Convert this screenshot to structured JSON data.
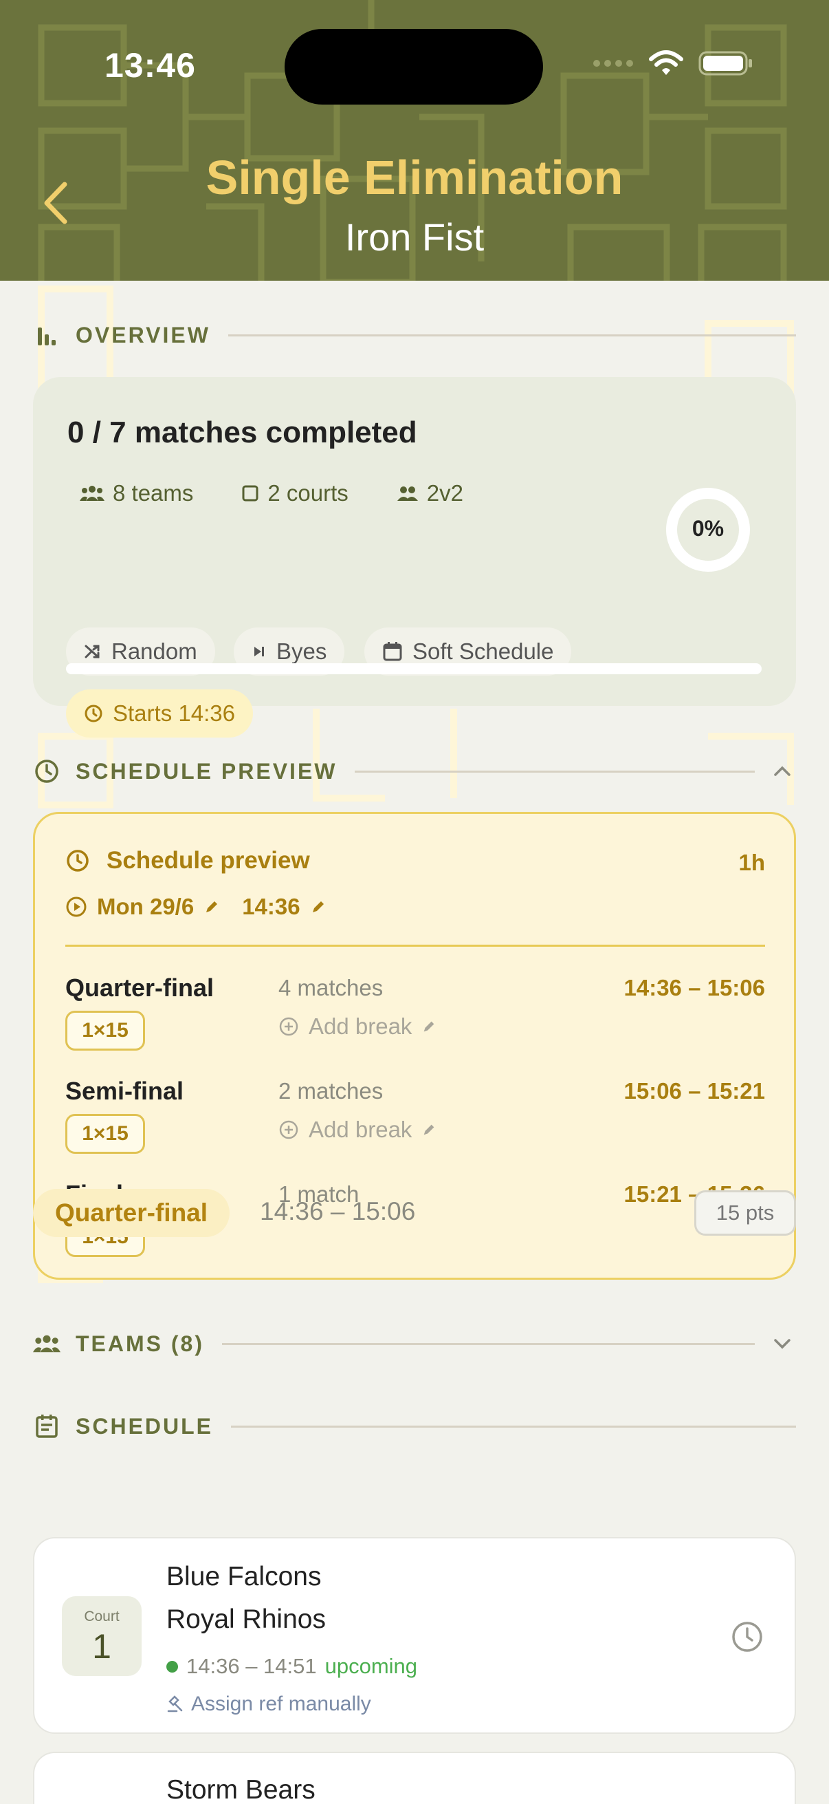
{
  "status_bar": {
    "time": "13:46"
  },
  "header": {
    "title": "Single Elimination",
    "subtitle": "Iron Fist"
  },
  "overview": {
    "section_label": "OVERVIEW",
    "title": "0 / 7 matches completed",
    "teams": "8 teams",
    "courts": "2 courts",
    "format": "2v2",
    "chips": [
      "Random",
      "Byes",
      "Soft Schedule"
    ],
    "starts": "Starts 14:36",
    "percent_label": "0%",
    "progress_fraction": 0
  },
  "schedule_preview": {
    "section_label": "SCHEDULE PREVIEW",
    "title": "Schedule preview",
    "duration": "1h",
    "start_date": "Mon 29/6",
    "start_time": "14:36",
    "rounds": [
      {
        "name": "Quarter-final",
        "format": "1×15",
        "count": "4 matches",
        "add_break": "Add break",
        "time": "14:36 – 15:06"
      },
      {
        "name": "Semi-final",
        "format": "1×15",
        "count": "2 matches",
        "add_break": "Add break",
        "time": "15:06 – 15:21"
      },
      {
        "name": "Final",
        "format": "1×15",
        "count": "1 match",
        "add_break": "",
        "time": "15:21 – 15:36"
      }
    ]
  },
  "teams_section": {
    "label": "TEAMS (8)"
  },
  "schedule": {
    "section_label": "SCHEDULE",
    "phase": "Quarter-final",
    "phase_time": "14:36 – 15:06",
    "points": "15 pts",
    "matches": [
      {
        "court_label": "Court",
        "court_number": "1",
        "team_a": "Blue Falcons",
        "team_b": "Royal Rhinos",
        "time": "14:36 – 14:51",
        "status": "upcoming",
        "ref_action": "Assign ref manually"
      },
      {
        "team_a": "Storm Bears"
      }
    ]
  },
  "colors": {
    "header_bg": "#6b733d",
    "title_gold": "#f1cf6c",
    "accent_olive": "#67703b",
    "accent_amber": "#a97f10",
    "status_green": "#4caf50"
  }
}
